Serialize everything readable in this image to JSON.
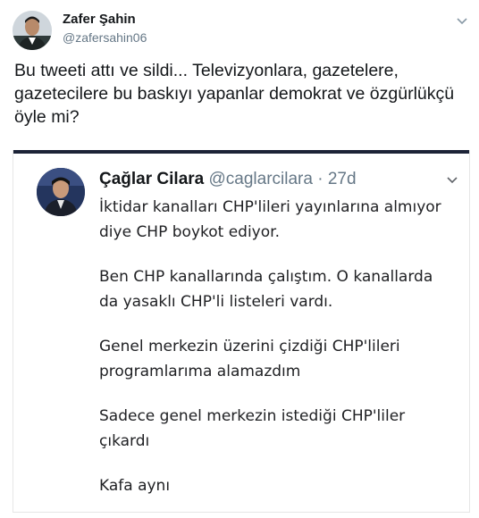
{
  "tweet": {
    "author_name": "Zafer Şahin",
    "author_handle": "@zafersahin06",
    "text_lines": [
      "Bu tweeti attı ve sildi... Televizyonlara, gazetelere,",
      "gazetecilere bu baskıyı yapanlar demokrat ve özgürlükçü",
      "öyle mi?"
    ]
  },
  "quoted": {
    "author_name": "Çağlar Cilara",
    "author_handle": "@caglarcilara",
    "separator": "·",
    "time": "27d",
    "paragraphs": [
      [
        "İktidar kanalları CHP'lileri yayınlarına almıyor",
        "diye CHP boykot ediyor."
      ],
      [
        "Ben CHP kanallarında çalıştım. O kanallarda",
        "da yasaklı CHP'li listeleri vardı."
      ],
      [
        "Genel merkezin üzerini çizdiği CHP'lileri",
        "programlarıma alamazdım"
      ],
      [
        "Sadece genel merkezin istediği CHP'liler",
        "çıkardı"
      ],
      [
        "Kafa aynı"
      ]
    ]
  },
  "icons": {
    "menu_chevron": "chevron-down-icon"
  },
  "colors": {
    "text": "#14171a",
    "secondary": "#657786",
    "quote_border_top": "#1c2337"
  }
}
